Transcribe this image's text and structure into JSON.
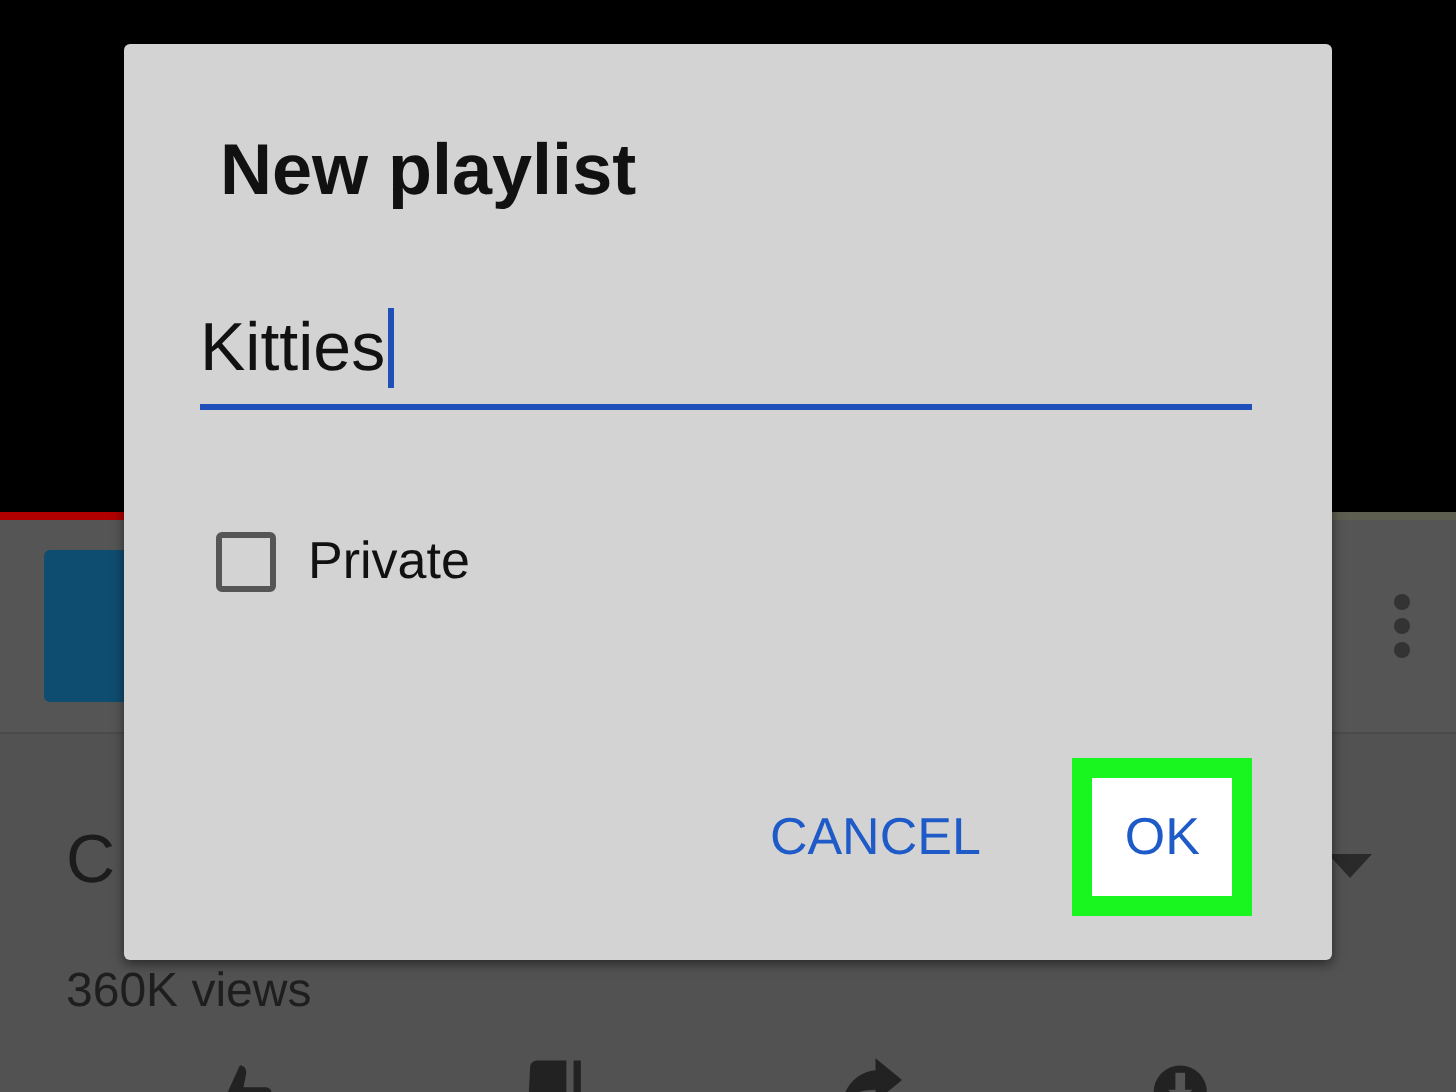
{
  "video": {
    "progress": {
      "level": 0.09
    }
  },
  "video_info": {
    "title": "C",
    "views": "360K views"
  },
  "dialog": {
    "title": "New playlist",
    "name_field": {
      "value": "Kitties"
    },
    "private": {
      "label": "Private",
      "checked": false
    },
    "buttons": [
      {
        "label": "CANCEL",
        "highlighted": false
      },
      {
        "label": "OK",
        "highlighted": true
      }
    ]
  }
}
